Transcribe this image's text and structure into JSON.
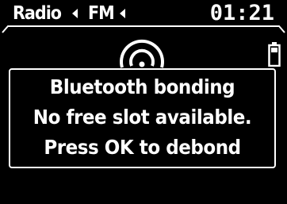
{
  "status_bar": {
    "source": "Radio",
    "band": "FM",
    "time": "01:21"
  },
  "icons": {
    "back_arrow": "left-triangle-icon",
    "signal": "broadcast-signal-icon",
    "battery": "battery-icon"
  },
  "dialog": {
    "title": "Bluetooth bonding",
    "message": "No free slot available.",
    "instruction": "Press OK to debond"
  },
  "colors": {
    "background": "#000000",
    "foreground": "#ffffff"
  }
}
